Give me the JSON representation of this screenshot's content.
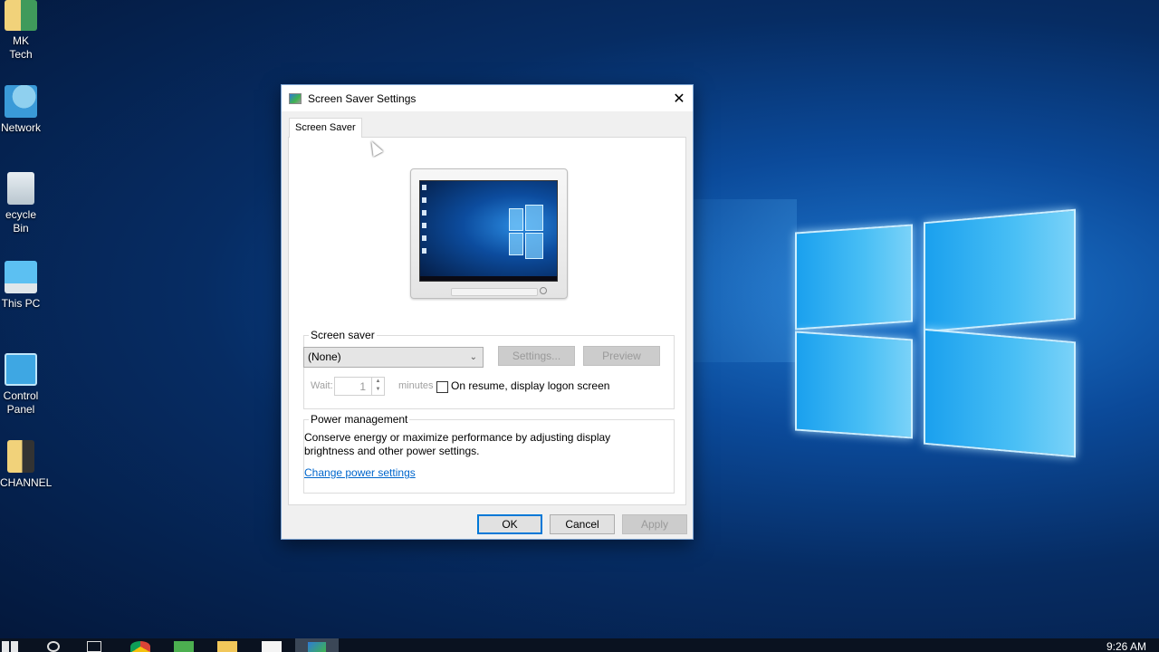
{
  "desktop": {
    "icons": [
      {
        "label": "MK Tech",
        "icon": "user-folder-icon"
      },
      {
        "label": "Network",
        "icon": "network-icon"
      },
      {
        "label": "ecycle Bin",
        "icon": "recycle-bin-icon"
      },
      {
        "label": "This PC",
        "icon": "computer-icon"
      },
      {
        "label": "Control Panel",
        "icon": "control-panel-icon"
      },
      {
        "label": "CHANNEL",
        "icon": "music-folder-icon"
      }
    ]
  },
  "dialog": {
    "title": "Screen Saver Settings",
    "close_label": "✕",
    "tab_label": "Screen Saver",
    "screen_saver_group": {
      "label": "Screen saver",
      "selected": "(None)",
      "settings_label": "Settings...",
      "preview_label": "Preview",
      "wait_label": "Wait:",
      "wait_value": "1",
      "minutes_label": "minutes",
      "logon_checkbox_label": "On resume, display logon screen",
      "logon_checked": false
    },
    "power_group": {
      "label": "Power management",
      "description": "Conserve energy or maximize performance by adjusting display brightness and other power settings.",
      "link_label": "Change power settings"
    },
    "buttons": {
      "ok": "OK",
      "cancel": "Cancel",
      "apply": "Apply"
    }
  },
  "taskbar": {
    "items": [
      "start-icon",
      "search-icon",
      "task-view-icon",
      "chrome-icon",
      "camtasia-icon",
      "file-explorer-icon",
      "camtasia-recorder-icon",
      "screen-saver-settings-icon"
    ],
    "clock": "9:26 AM"
  },
  "colors": {
    "accent": "#0078d7",
    "link": "#0066cc",
    "dialog_bg": "#f0f0f0",
    "taskbar": "#0a1220"
  }
}
